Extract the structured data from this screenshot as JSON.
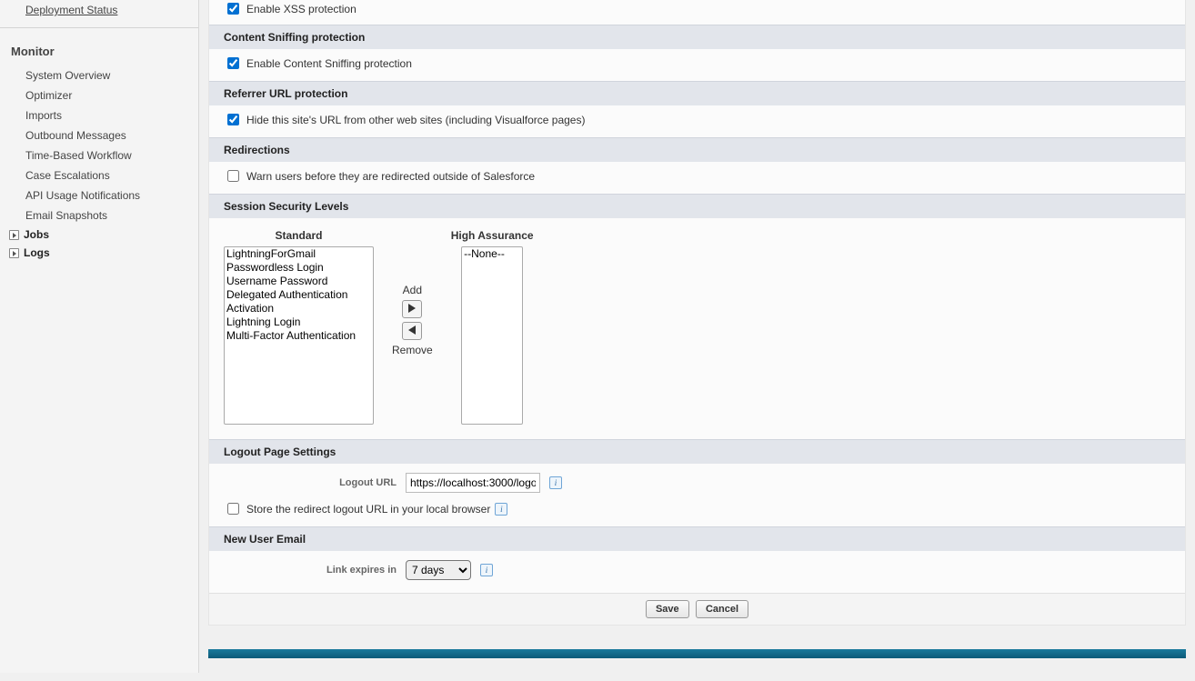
{
  "sidebar": {
    "top_items": [
      {
        "label": "Deployment Status"
      }
    ],
    "section_title": "Monitor",
    "monitor_items": [
      {
        "label": "System Overview"
      },
      {
        "label": "Optimizer"
      },
      {
        "label": "Imports"
      },
      {
        "label": "Outbound Messages"
      },
      {
        "label": "Time-Based Workflow"
      },
      {
        "label": "Case Escalations"
      },
      {
        "label": "API Usage Notifications"
      },
      {
        "label": "Email Snapshots"
      }
    ],
    "tree_items": [
      {
        "label": "Jobs"
      },
      {
        "label": "Logs"
      }
    ]
  },
  "sections": {
    "xss": {
      "checkbox_label": "Enable XSS protection"
    },
    "content_sniffing": {
      "title": "Content Sniffing protection",
      "checkbox_label": "Enable Content Sniffing protection"
    },
    "referrer": {
      "title": "Referrer URL protection",
      "checkbox_label": "Hide this site's URL from other web sites (including Visualforce pages)"
    },
    "redirections": {
      "title": "Redirections",
      "checkbox_label": "Warn users before they are redirected outside of Salesforce"
    },
    "session_security": {
      "title": "Session Security Levels",
      "standard_label": "Standard",
      "high_assurance_label": "High Assurance",
      "add_label": "Add",
      "remove_label": "Remove",
      "standard_options": [
        "LightningForGmail",
        "Passwordless Login",
        "Username Password",
        "Delegated Authentication",
        "Activation",
        "Lightning Login",
        "Multi-Factor Authentication"
      ],
      "high_options": [
        "--None--"
      ]
    },
    "logout": {
      "title": "Logout Page Settings",
      "url_label": "Logout URL",
      "url_value": "https://localhost:3000/logo",
      "store_label": "Store the redirect logout URL in your local browser"
    },
    "new_user_email": {
      "title": "New User Email",
      "expires_label": "Link expires in",
      "expires_value": "7 days"
    }
  },
  "buttons": {
    "save": "Save",
    "cancel": "Cancel"
  }
}
